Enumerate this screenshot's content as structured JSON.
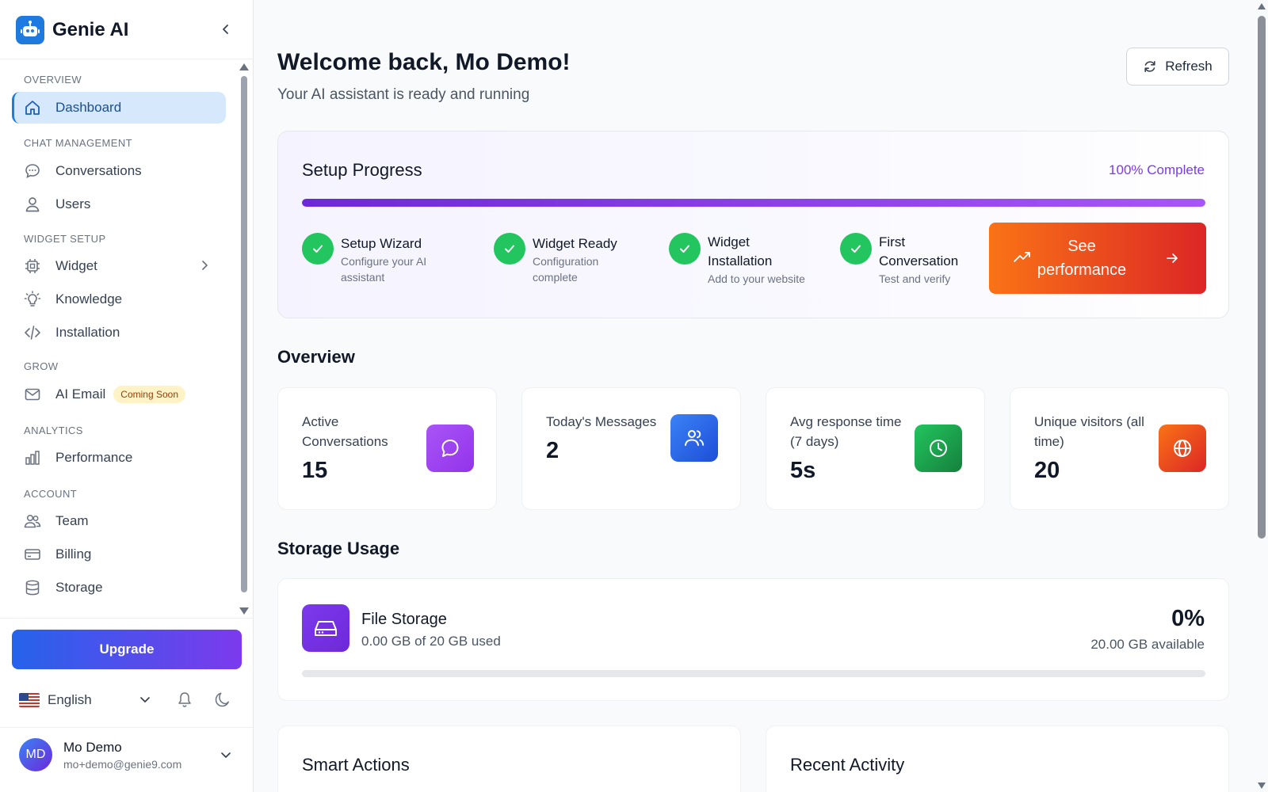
{
  "sidebar": {
    "brand": "Genie AI",
    "sections": {
      "overview": "OVERVIEW",
      "chat": "CHAT MANAGEMENT",
      "widget": "WIDGET SETUP",
      "grow": "GROW",
      "analytics": "ANALYTICS",
      "account": "ACCOUNT"
    },
    "items": {
      "dashboard": "Dashboard",
      "conversations": "Conversations",
      "users": "Users",
      "widget": "Widget",
      "knowledge": "Knowledge",
      "installation": "Installation",
      "ai_email": "AI Email",
      "ai_email_badge": "Coming Soon",
      "performance": "Performance",
      "team": "Team",
      "billing": "Billing",
      "storage": "Storage"
    },
    "active_item": "dashboard",
    "upgrade": "Upgrade",
    "language": "English",
    "user": {
      "initials": "MD",
      "name": "Mo Demo",
      "email": "mo+demo@genie9.com"
    },
    "icons": [
      "robot-icon",
      "home-icon",
      "chat-bubble-icon",
      "user-icon",
      "chip-icon",
      "lightbulb-icon",
      "code-icon",
      "mail-icon",
      "bar-chart-icon",
      "team-icon",
      "credit-card-icon",
      "database-icon",
      "bell-icon",
      "moon-icon"
    ]
  },
  "header": {
    "title": "Welcome back, Mo Demo!",
    "subtitle": "Your AI assistant is ready and running",
    "refresh": "Refresh"
  },
  "setup": {
    "title": "Setup Progress",
    "percent_label": "100% Complete",
    "progress": 1.0,
    "steps": [
      {
        "title": "Setup Wizard",
        "desc": "Configure your AI assistant",
        "done": true
      },
      {
        "title": "Widget Ready",
        "desc": "Configuration complete",
        "done": true
      },
      {
        "title": "Widget Installation",
        "desc": "Add to your website",
        "done": true
      },
      {
        "title": "First Conversation",
        "desc": "Test and verify",
        "done": true
      }
    ],
    "cta": "See performance"
  },
  "overview": {
    "title": "Overview",
    "stats": [
      {
        "label": "Active Conversations",
        "value": "15",
        "icon": "chat-bubble-icon",
        "color": "#9333ea"
      },
      {
        "label": "Today's Messages",
        "value": "2",
        "icon": "users-icon",
        "color": "#2563eb"
      },
      {
        "label": "Avg response time (7 days)",
        "value": "5s",
        "icon": "clock-icon",
        "color": "#16a34a"
      },
      {
        "label": "Unique visitors (all time)",
        "value": "20",
        "icon": "globe-icon",
        "color": "#ea580c"
      }
    ]
  },
  "storage": {
    "title": "Storage Usage",
    "card_title": "File Storage",
    "used_text": "0.00 GB of 20 GB used",
    "percent": "0%",
    "available": "20.00 GB available",
    "fraction": 0.0
  },
  "panels": {
    "smart_actions": "Smart Actions",
    "recent_activity": "Recent Activity"
  },
  "colors": {
    "primary": "#1f7ae0",
    "accent": "#7c3aed",
    "success": "#22c55e",
    "cta_start": "#f97316",
    "cta_end": "#dc2626"
  }
}
